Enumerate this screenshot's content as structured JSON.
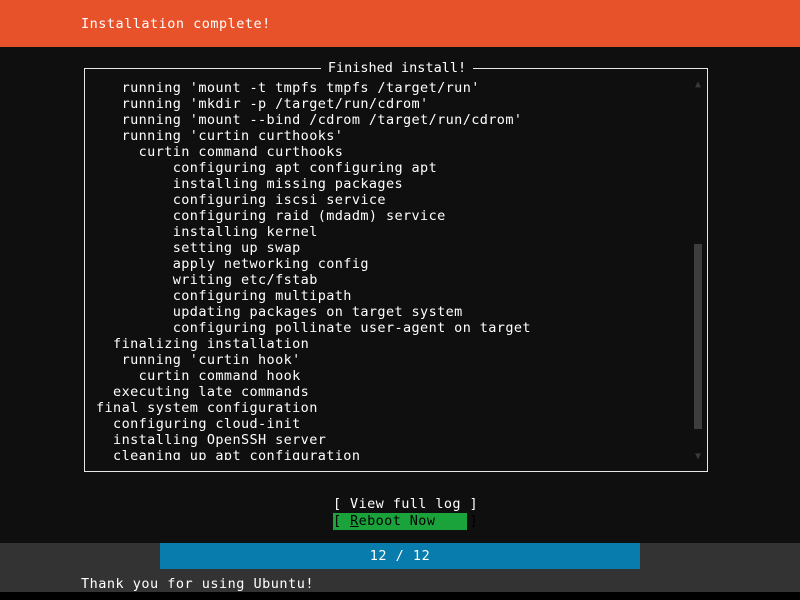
{
  "header": {
    "title": "Installation complete!",
    "background": "#e8522a",
    "text_color": "#ffffff"
  },
  "log_panel": {
    "title": "Finished install!",
    "border_color": "#e6e6e6",
    "lines": [
      "   running 'mount -t tmpfs tmpfs /target/run'",
      "   running 'mkdir -p /target/run/cdrom'",
      "   running 'mount --bind /cdrom /target/run/cdrom'",
      "   running 'curtin curthooks'",
      "     curtin command curthooks",
      "         configuring apt configuring apt",
      "         installing missing packages",
      "         configuring iscsi service",
      "         configuring raid (mdadm) service",
      "         installing kernel",
      "         setting up swap",
      "         apply networking config",
      "         writing etc/fstab",
      "         configuring multipath",
      "         updating packages on target system",
      "         configuring pollinate user-agent on target",
      "  finalizing installation",
      "   running 'curtin hook'",
      "     curtin command hook",
      "  executing late commands",
      "final system configuration",
      "  configuring cloud-init",
      "  installing OpenSSH server",
      "  cleaning up apt configuration"
    ],
    "scrollbar": {
      "up_arrow": "▲",
      "down_arrow": "▼",
      "thumb_color": "#3d3d3d"
    }
  },
  "buttons": {
    "view_full_log": "[ View full log ]",
    "reboot_prefix": "[ ",
    "reboot_hotkey": "R",
    "reboot_rest": "eboot Now    ]",
    "selected_background": "#1aa33a",
    "selected_text_color": "#000000"
  },
  "progress": {
    "label": "12 / 12",
    "current": 12,
    "total": 12,
    "percent": 100,
    "fill_color": "#087cac",
    "track_color": "#333333"
  },
  "footer": {
    "message": "Thank you for using Ubuntu!",
    "background": "#333333",
    "text_color": "#ffffff"
  }
}
